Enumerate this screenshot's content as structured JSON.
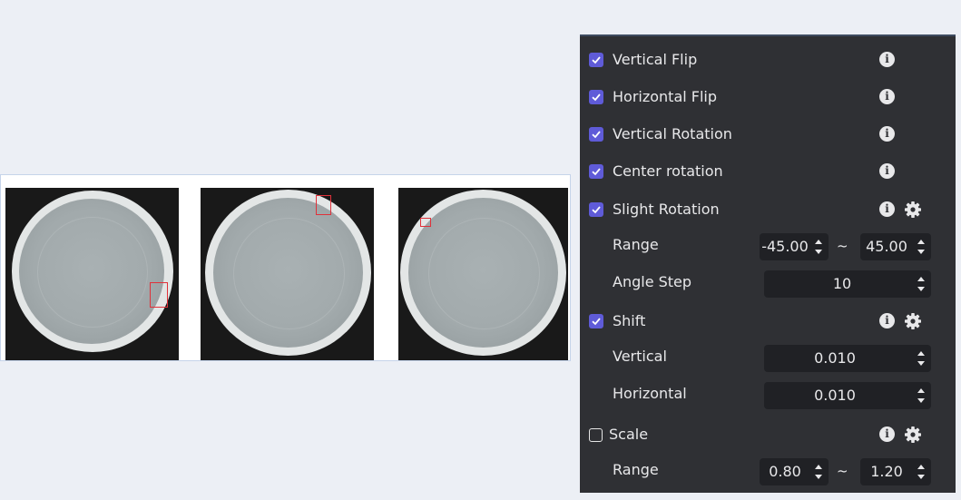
{
  "augmentations": [
    {
      "label": "Vertical Flip",
      "checked": true,
      "has_settings": false
    },
    {
      "label": "Horizontal Flip",
      "checked": true,
      "has_settings": false
    },
    {
      "label": "Vertical Rotation",
      "checked": true,
      "has_settings": false
    },
    {
      "label": "Center rotation",
      "checked": true,
      "has_settings": false
    },
    {
      "label": "Slight Rotation",
      "checked": true,
      "has_settings": true,
      "range_label": "Range",
      "range_min": "-45.00",
      "range_max": "45.00",
      "range_sep": "~",
      "step_label": "Angle Step",
      "step_value": "10"
    },
    {
      "label": "Shift",
      "checked": true,
      "has_settings": true,
      "vertical_label": "Vertical",
      "vertical_value": "0.010",
      "horizontal_label": "Horizontal",
      "horizontal_value": "0.010"
    },
    {
      "label": "Scale",
      "checked": false,
      "has_settings": true,
      "range_label": "Range",
      "range_min": "0.80",
      "range_max": "1.20",
      "range_sep": "~"
    }
  ],
  "icons": {
    "info": "info-icon",
    "settings": "gear-icon",
    "stepper": "up-down-arrows-icon",
    "check": "checkmark-icon"
  },
  "colors": {
    "checkbox_accent": "#5f5bd8",
    "panel_bg": "#2f3034",
    "defect_box": "#e0313a"
  },
  "images": [
    {
      "name": "sample-image-1",
      "has_defect_box": true
    },
    {
      "name": "sample-image-2",
      "has_defect_box": true
    },
    {
      "name": "sample-image-3",
      "has_defect_box": true
    }
  ]
}
